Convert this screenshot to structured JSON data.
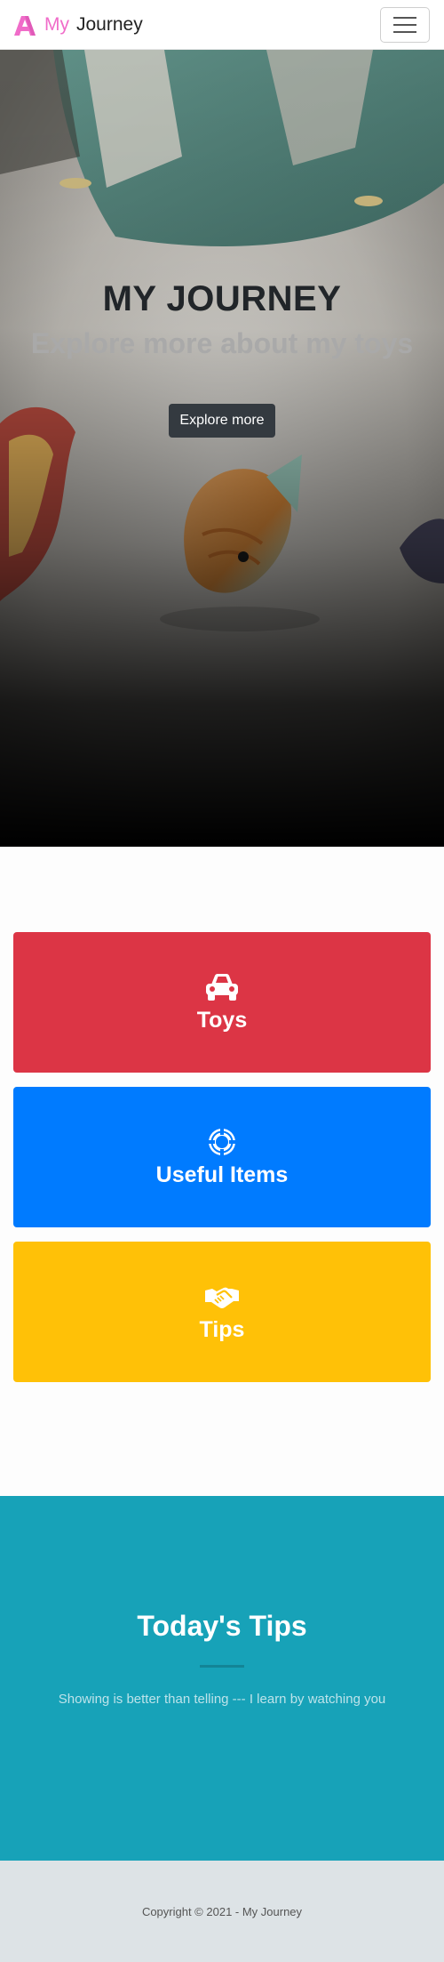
{
  "navbar": {
    "brand_my": "My",
    "brand_rest": "Journey",
    "logo_icon": "letter-a-logo-icon",
    "menu_icon": "hamburger-menu-icon",
    "brand_color": "#f06cc9"
  },
  "hero": {
    "title": "MY JOURNEY",
    "subtitle": "Explore more about my toys",
    "button_label": "Explore more"
  },
  "categories": [
    {
      "label": "Toys",
      "icon": "car-icon",
      "color": "#dc3545"
    },
    {
      "label": "Useful Items",
      "icon": "life-ring-icon",
      "color": "#007bff"
    },
    {
      "label": "Tips",
      "icon": "handshake-icon",
      "color": "#ffc107"
    }
  ],
  "tips": {
    "title": "Today's Tips",
    "text": "Showing is better than telling --- I learn by watching you",
    "color": "#17a2b8"
  },
  "footer": {
    "copyright": "Copyright © 2021 - My Journey"
  }
}
